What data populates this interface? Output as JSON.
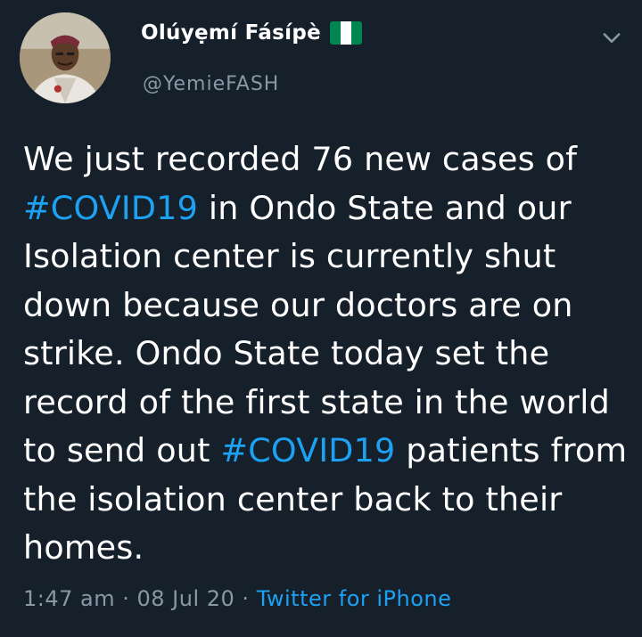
{
  "author": {
    "name": "Olúyẹmí Fásípè",
    "handle": "@YemieFASH",
    "flag_icon": "nigeria-flag-icon",
    "avatar_icon": "profile-photo"
  },
  "tweet": {
    "text_before": "We just recorded 76 new cases of ",
    "hashtag_1": "#COVID19",
    "text_middle": " in Ondo State and our Isolation center is currently shut down because our doctors are on strike. Ondo State today set the record of the first state in the world to send out ",
    "hashtag_2": "#COVID19",
    "text_after": " patients from the isolation center back to their homes."
  },
  "meta": {
    "time": "1:47 am",
    "separator_1": " · ",
    "date": "08 Jul 20",
    "separator_2": " · ",
    "source": "Twitter for iPhone"
  },
  "colors": {
    "background": "#15202b",
    "text": "#ffffff",
    "secondary": "#8899a6",
    "accent": "#1da1f2"
  }
}
